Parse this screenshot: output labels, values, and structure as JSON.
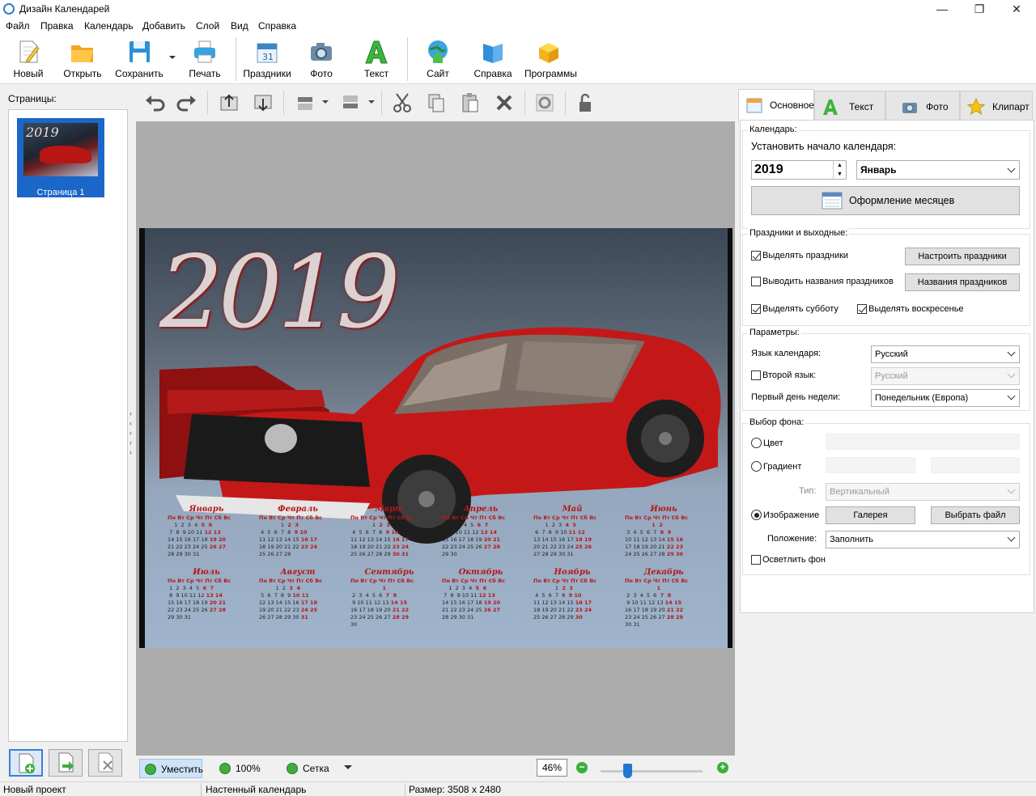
{
  "window": {
    "title": "Дизайн Календарей",
    "minimize": "—",
    "restore": "❐",
    "close": "✕"
  },
  "menu": [
    "Файл",
    "Правка",
    "Календарь",
    "Добавить",
    "Слой",
    "Вид",
    "Справка"
  ],
  "toolbar": {
    "new": "Новый",
    "open": "Открыть",
    "save": "Сохранить",
    "print": "Печать",
    "holidays": "Праздники",
    "photo": "Фото",
    "text": "Текст",
    "site": "Сайт",
    "help": "Справка",
    "programs": "Программы"
  },
  "pages": {
    "label": "Страницы:",
    "thumb_label": "Страница 1",
    "thumb_year": "2019"
  },
  "canvas": {
    "year": "2019",
    "weekdays": "Пн Вт Ср Чт Пт Сб Вс",
    "months": [
      "Январь",
      "Февраль",
      "Март",
      "Апрель",
      "Май",
      "Июнь",
      "Июль",
      "Август",
      "Сентябрь",
      "Октябрь",
      "Ноябрь",
      "Декабрь"
    ]
  },
  "bottombar": {
    "fit": "Уместить",
    "zoom100": "100%",
    "grid": "Сетка",
    "zoom_value": "46%",
    "zoom_minus": "−",
    "zoom_plus": "+",
    "zoom_level_percent": 46
  },
  "statusbar": {
    "project": "Новый проект",
    "type": "Настенный календарь",
    "size": "Размер: 3508 x 2480"
  },
  "tabs": {
    "basic": "Основное",
    "text": "Текст",
    "photo": "Фото",
    "clipart": "Клипарт"
  },
  "calendar_group": {
    "title": "Календарь:",
    "start_label": "Установить начало календаря:",
    "year": "2019",
    "month": "Январь",
    "months_design": "Оформление месяцев"
  },
  "holidays_group": {
    "title": "Праздники и выходные:",
    "highlight_holidays": "Выделять праздники",
    "configure_holidays": "Настроить праздники",
    "show_names": "Выводить названия праздников",
    "holiday_names": "Названия праздников",
    "highlight_saturday": "Выделять субботу",
    "highlight_sunday": "Выделять воскресенье"
  },
  "params_group": {
    "title": "Параметры:",
    "language_label": "Язык календаря:",
    "language": "Русский",
    "second_language_label": "Второй язык:",
    "second_language": "Русский",
    "first_day_label": "Первый день недели:",
    "first_day": "Понедельник (Европа)"
  },
  "background_group": {
    "title": "Выбор фона:",
    "color": "Цвет",
    "gradient": "Градиент",
    "type_label": "Тип:",
    "type": "Вертикальный",
    "image": "Изображение",
    "gallery": "Галерея",
    "choose_file": "Выбрать файл",
    "position_label": "Положение:",
    "position": "Заполнить",
    "lighten": "Осветлить фон"
  }
}
